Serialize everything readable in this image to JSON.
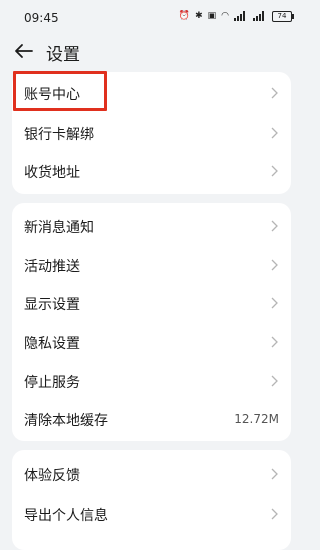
{
  "status": {
    "time": "09:45",
    "battery": "74"
  },
  "header": {
    "title": "设置"
  },
  "group1": [
    {
      "label": "账号中心"
    },
    {
      "label": "银行卡解绑"
    },
    {
      "label": "收货地址"
    }
  ],
  "group2": [
    {
      "label": "新消息通知"
    },
    {
      "label": "活动推送"
    },
    {
      "label": "显示设置"
    },
    {
      "label": "隐私设置"
    },
    {
      "label": "停止服务"
    },
    {
      "label": "清除本地缓存",
      "value": "12.72M"
    }
  ],
  "group3": [
    {
      "label": "体验反馈"
    },
    {
      "label": "导出个人信息"
    }
  ],
  "colors": {
    "highlight": "#e0301e",
    "background": "#f1f3f5"
  }
}
